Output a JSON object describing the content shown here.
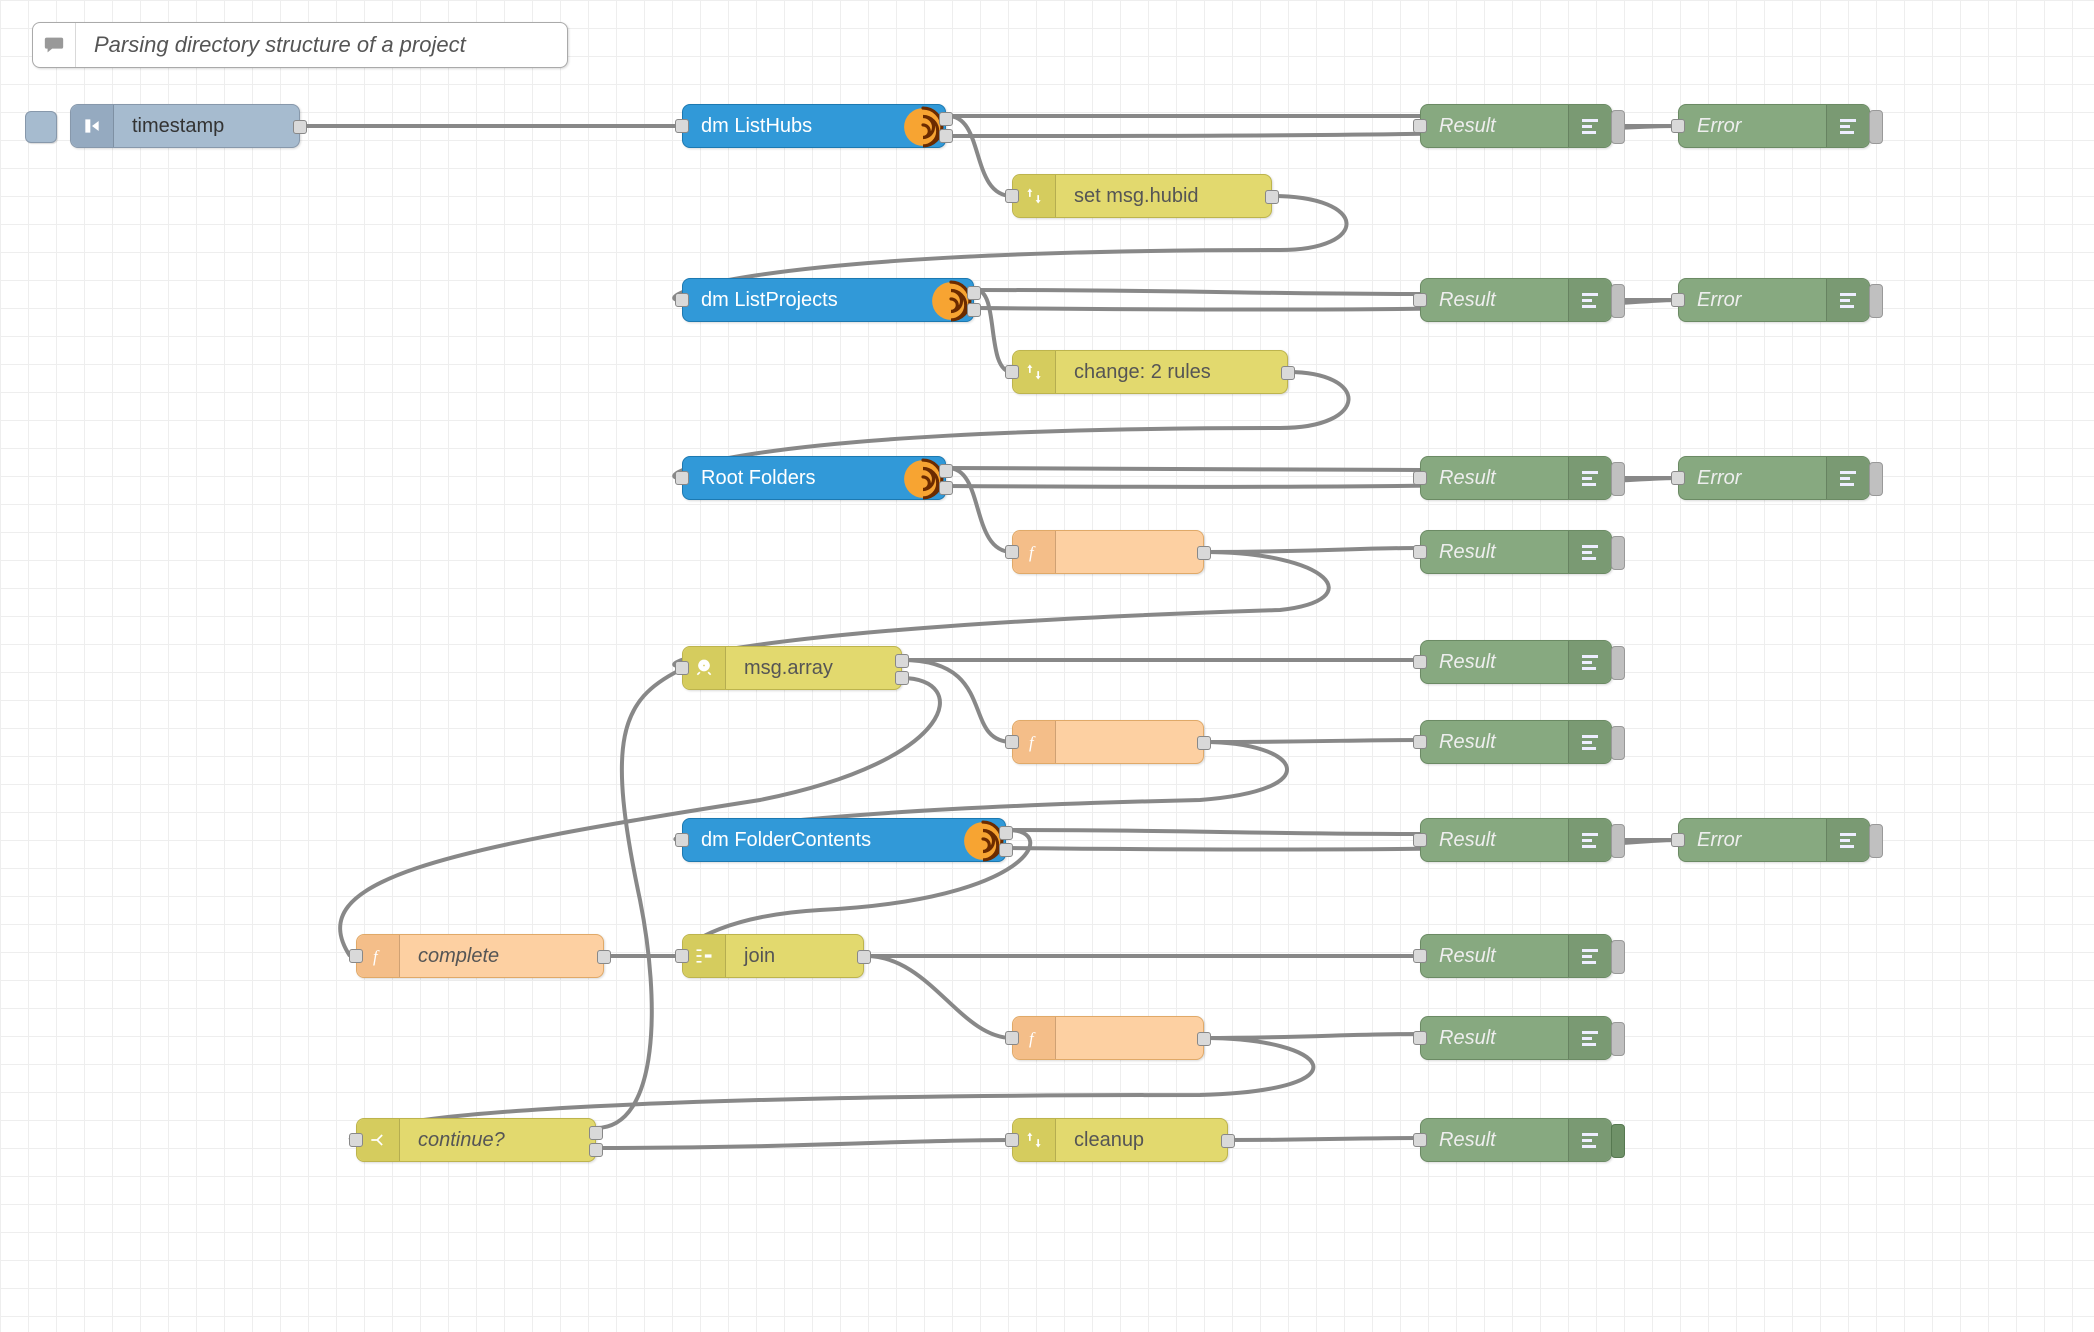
{
  "comment": {
    "text": "Parsing directory structure of a project"
  },
  "inject": {
    "label": "timestamp"
  },
  "forge": {
    "listHubs": "dm ListHubs",
    "listProjects": "dm ListProjects",
    "rootFolders": "Root Folders",
    "folderContents": "dm FolderContents"
  },
  "change": {
    "setHubId": "set msg.hubid",
    "twoRules": "change: 2 rules",
    "cleanup": "cleanup"
  },
  "split": {
    "msgArray": "msg.array"
  },
  "join": {
    "label": "join"
  },
  "switch": {
    "continue": "continue?"
  },
  "fn": {
    "complete": "complete",
    "blank": ""
  },
  "debug": {
    "result": "Result",
    "error": "Error"
  },
  "wires": [
    {
      "from": "inject.out",
      "to": "listHubs.in"
    },
    {
      "from": "listHubs.out1",
      "to": "result1.in"
    },
    {
      "from": "listHubs.out2",
      "to": "error1.in"
    },
    {
      "from": "listHubs.out1",
      "to": "setHubId.in"
    },
    {
      "from": "setHubId.out",
      "to": "listProjects.in"
    },
    {
      "from": "listProjects.out1",
      "to": "result2.in"
    },
    {
      "from": "listProjects.out2",
      "to": "error2.in"
    },
    {
      "from": "listProjects.out1",
      "to": "twoRules.in"
    },
    {
      "from": "twoRules.out",
      "to": "rootFolders.in"
    },
    {
      "from": "rootFolders.out1",
      "to": "result3.in"
    },
    {
      "from": "rootFolders.out2",
      "to": "error3.in"
    },
    {
      "from": "rootFolders.out1",
      "to": "fn1.in"
    },
    {
      "from": "fn1.out",
      "to": "result4.in"
    },
    {
      "from": "fn1.out",
      "to": "msgArray.in"
    },
    {
      "from": "msgArray.out1",
      "to": "result5.in"
    },
    {
      "from": "msgArray.out1",
      "to": "fn2.in"
    },
    {
      "from": "msgArray.out2",
      "to": "complete.in"
    },
    {
      "from": "fn2.out",
      "to": "result6.in"
    },
    {
      "from": "fn2.out",
      "to": "folderContents.in"
    },
    {
      "from": "folderContents.out1",
      "to": "result7.in"
    },
    {
      "from": "folderContents.out2",
      "to": "error4.in"
    },
    {
      "from": "folderContents.out1",
      "to": "join.in"
    },
    {
      "from": "complete.out",
      "to": "join.in"
    },
    {
      "from": "join.out",
      "to": "result8.in"
    },
    {
      "from": "join.out",
      "to": "fn3.in"
    },
    {
      "from": "fn3.out",
      "to": "result9.in"
    },
    {
      "from": "fn3.out",
      "to": "continue.in"
    },
    {
      "from": "continue.out1",
      "to": "msgArray.in"
    },
    {
      "from": "continue.out2",
      "to": "cleanup.in"
    },
    {
      "from": "cleanup.out",
      "to": "result10.in"
    }
  ]
}
